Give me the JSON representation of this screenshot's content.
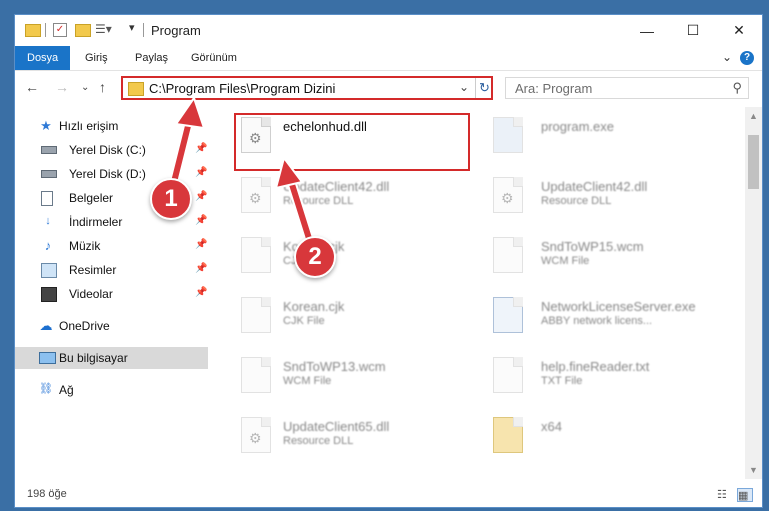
{
  "window": {
    "title": "Program"
  },
  "ribbon": {
    "tabs": [
      {
        "label": "Dosya",
        "active": true
      },
      {
        "label": "Giriş"
      },
      {
        "label": "Paylaş"
      },
      {
        "label": "Görünüm"
      }
    ]
  },
  "address": {
    "path": "C:\\Program Files\\Program Dizini"
  },
  "search": {
    "placeholder": "Ara: Program"
  },
  "sidebar": {
    "items": [
      {
        "label": "Hızlı erişim",
        "icon": "star-icon"
      },
      {
        "label": "Yerel Disk (C:)",
        "icon": "drive-icon",
        "pinned": true
      },
      {
        "label": "Yerel Disk (D:)",
        "icon": "drive-icon",
        "pinned": true
      },
      {
        "label": "Belgeler",
        "icon": "documents-icon",
        "pinned": true
      },
      {
        "label": "İndirmeler",
        "icon": "download-icon",
        "pinned": true
      },
      {
        "label": "Müzik",
        "icon": "music-icon",
        "pinned": true
      },
      {
        "label": "Resimler",
        "icon": "pictures-icon",
        "pinned": true
      },
      {
        "label": "Videolar",
        "icon": "video-icon",
        "pinned": true
      },
      {
        "label": "OneDrive",
        "icon": "cloud-icon"
      },
      {
        "label": "Bu bilgisayar",
        "icon": "computer-icon",
        "selected": true
      },
      {
        "label": "Ağ",
        "icon": "network-icon"
      }
    ]
  },
  "files": [
    {
      "name": "echelonhud.dll",
      "type": ""
    },
    {
      "name": "program.exe",
      "type": ""
    },
    {
      "name": "UpdateClient42.dll",
      "type": "Resource DLL"
    },
    {
      "name": "UpdateClient42.dll",
      "type": "Resource DLL"
    },
    {
      "name": "Korean.cjk",
      "type": "CJK File"
    },
    {
      "name": "SndToWP15.wcm",
      "type": "WCM File"
    },
    {
      "name": "Korean.cjk",
      "type": "CJK File"
    },
    {
      "name": "NetworkLicenseServer.exe",
      "type": "ABBY network licens..."
    },
    {
      "name": "SndToWP13.wcm",
      "type": "WCM File"
    },
    {
      "name": "help.fineReader.txt",
      "type": "TXT File"
    },
    {
      "name": "UpdateClient65.dll",
      "type": "Resource DLL"
    },
    {
      "name": "x64",
      "type": ""
    }
  ],
  "status": {
    "count": "198 öğe"
  },
  "annotations": {
    "step1": "1",
    "step2": "2"
  },
  "colors": {
    "accent": "#1a74c8",
    "annotation": "#d8373b",
    "highlight": "#d42a2a"
  }
}
